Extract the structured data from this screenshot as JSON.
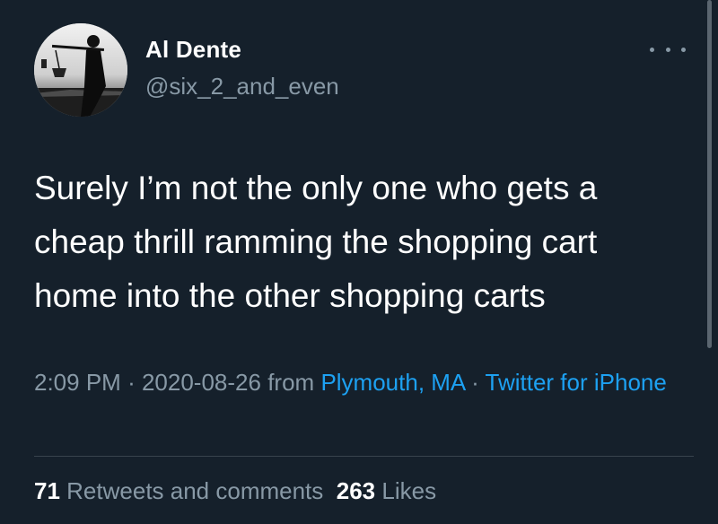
{
  "tweet": {
    "display_name": "Al Dente",
    "handle": "@six_2_and_even",
    "more_icon": "more-horizontal-icon",
    "text": "Surely I’m not the only one who gets a cheap thrill ramming the shopping cart home into the other shopping carts",
    "time": "2:09 PM",
    "separator": "·",
    "date": "2020-08-26",
    "from_label": "from",
    "location": "Plymouth, MA",
    "source": "Twitter for iPhone",
    "retweets_count": "71",
    "retweets_label": "Retweets and comments",
    "likes_count": "263",
    "likes_label": "Likes"
  },
  "colors": {
    "background": "#15202b",
    "primary_text": "#ffffff",
    "secondary_text": "#8899a6",
    "link": "#1da1f2",
    "divider": "#38444d"
  }
}
